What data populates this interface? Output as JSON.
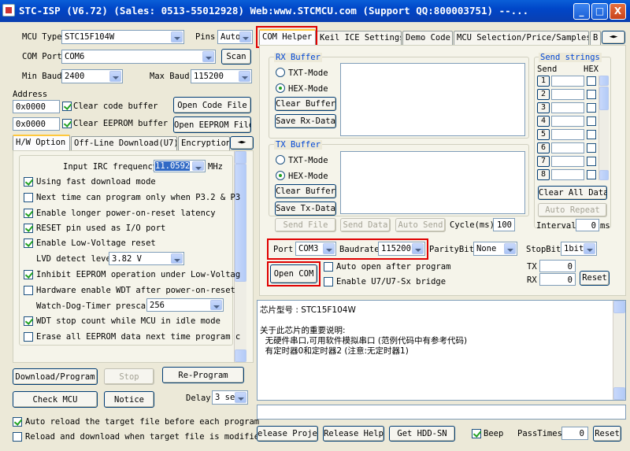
{
  "window": {
    "title": "STC-ISP (V6.72) (Sales: 0513-55012928) Web:www.STCMCU.com  (Support QQ:800003751)  --...",
    "min": "_",
    "max": "□",
    "close": "X"
  },
  "mcu": {
    "type_label": "MCU Type",
    "type_value": "STC15F104W",
    "pins_label": "Pins",
    "pins_value": "Auto",
    "port_label": "COM Port",
    "port_value": "COM6",
    "scan": "Scan",
    "minbaud_label": "Min Baud",
    "minbaud_value": "2400",
    "maxbaud_label": "Max Baud",
    "maxbaud_value": "115200"
  },
  "address": {
    "label": "Address",
    "code_addr": "0x0000",
    "clear_code": "Clear code buffer",
    "open_code": "Open Code File",
    "eeprom_addr": "0x0000",
    "clear_eeprom": "Clear EEPROM buffer",
    "open_eeprom": "Open EEPROM File"
  },
  "opt_tabs": [
    "H/W Option",
    "Off-Line Download(U7)",
    "Encryption"
  ],
  "hw": {
    "irc_label": "Input IRC frequency",
    "irc_value": "11.0592",
    "irc_unit": "MHz",
    "fast_dl": "Using fast download mode",
    "p32": "Next time can program only when P3.2 & P3",
    "longer_reset": "Enable longer power-on-reset latency",
    "reset_io": "RESET pin used as I/O port",
    "lvr": "Enable Low-Voltage reset",
    "lvd_label": "LVD detect leve",
    "lvd_value": "3.82 V",
    "inhibit": "Inhibit EEPROM operation under Low-Voltag",
    "wdt_hw": "Hardware enable WDT after power-on-reset",
    "wdt_pre_label": "Watch-Dog-Timer prescal",
    "wdt_pre_value": "256",
    "wdt_idle": "WDT stop count while MCU in idle mode",
    "erase": "Erase all EEPROM data next time program c"
  },
  "actions": {
    "download": "Download/Program",
    "stop": "Stop",
    "reprogram": "Re-Program",
    "check": "Check MCU",
    "notice": "Notice",
    "delay_label": "Delay",
    "delay_value": "3 se"
  },
  "bottom": {
    "auto_reload": "Auto reload the target file before each program",
    "reload_dl": "Reload and download when target file is modified"
  },
  "tabs": [
    "COM Helper",
    "Keil ICE Settings",
    "Demo Code",
    "MCU Selection/Price/Samples",
    "B"
  ],
  "rx": {
    "title": "RX Buffer",
    "txt": "TXT-Mode",
    "hex": "HEX-Mode",
    "clear": "Clear Buffer",
    "save": "Save Rx-Data"
  },
  "tx": {
    "title": "TX Buffer",
    "txt": "TXT-Mode",
    "hex": "HEX-Mode",
    "clear": "Clear Buffer",
    "save": "Save Tx-Data"
  },
  "send": {
    "title": "Send strings",
    "send_col": "Send",
    "hex_col": "HEX",
    "rows": [
      "1",
      "2",
      "3",
      "4",
      "5",
      "6",
      "7",
      "8"
    ],
    "clear_all": "Clear All Data",
    "auto_repeat": "Auto Repeat",
    "interval_label": "Interval",
    "interval_value": "0",
    "interval_unit": "ms"
  },
  "file": {
    "send_file": "Send File",
    "send_data": "Send Data",
    "auto_send": "Auto Send",
    "cycle_label": "Cycle(ms)",
    "cycle_value": "100"
  },
  "serial": {
    "port_label": "Port",
    "port_value": "COM3",
    "baud_label": "Baudrate",
    "baud_value": "115200",
    "parity_label": "ParityBit",
    "parity_value": "None",
    "stop_label": "StopBit",
    "stop_value": "1bit",
    "open": "Open COM",
    "auto_open": "Auto open after program",
    "u7": "Enable U7/U7-Sx bridge",
    "tx_label": "TX",
    "tx_value": "0",
    "rx_label": "RX",
    "rx_value": "0",
    "reset": "Reset"
  },
  "info": {
    "line1": "芯片型号 : STC15F104W",
    "line2": "关于此芯片的重要说明:",
    "line3": "  无硬件串口,可用软件模拟串口 (范例代码中有参考代码)",
    "line4": "  有定时器0和定时器2 (注意:无定时器1)"
  },
  "footer": {
    "release_proj": "elease Projec",
    "release_help": "Release Help",
    "get_hdd": "Get HDD-SN",
    "beep": "Beep",
    "pass_label": "PassTimes",
    "pass_value": "0",
    "reset": "Reset"
  }
}
